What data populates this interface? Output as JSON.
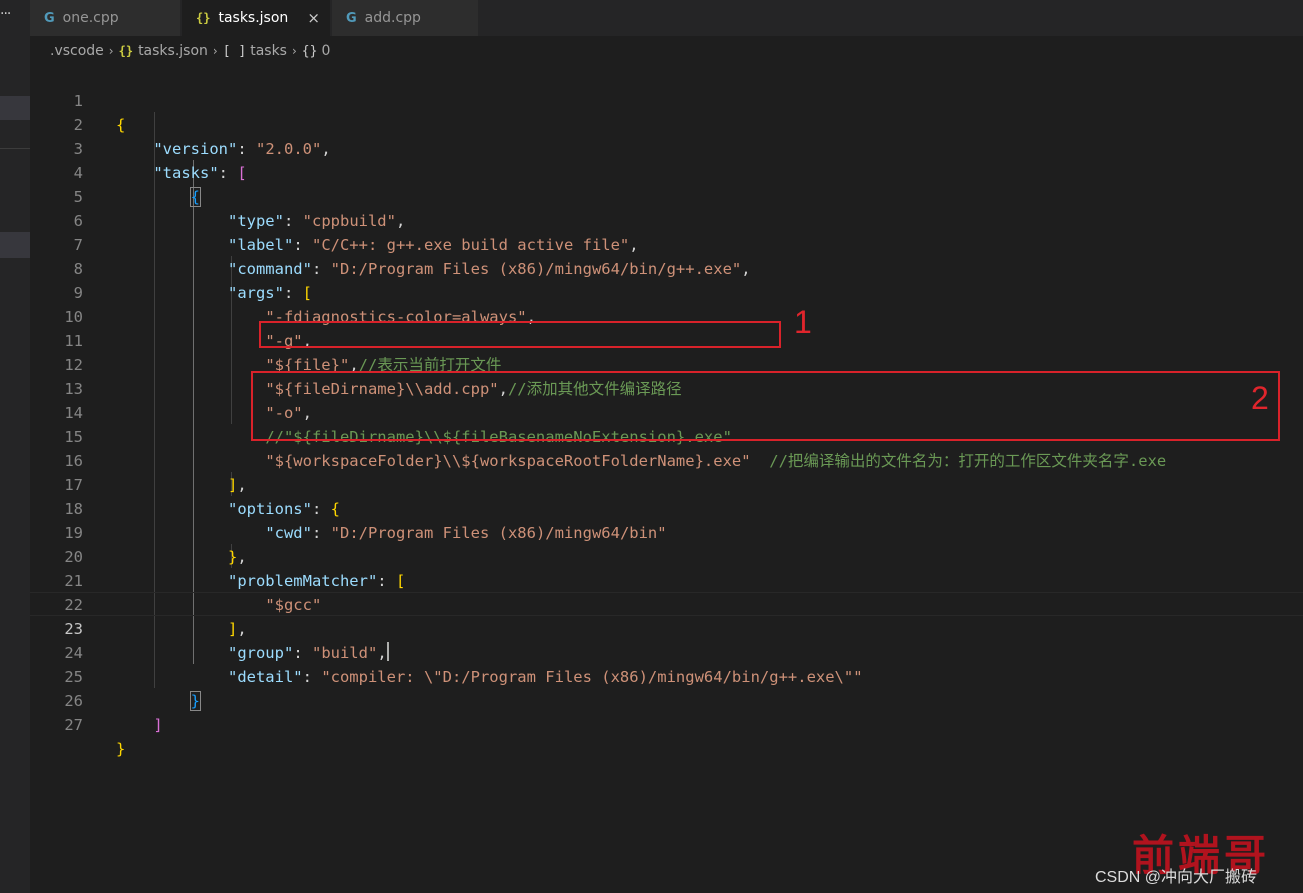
{
  "activitybar": {
    "more": "..."
  },
  "tabs": [
    {
      "label": "one.cpp",
      "icon": "cpp-file-icon",
      "icon_glyph": "G",
      "active": false
    },
    {
      "label": "tasks.json",
      "icon": "json-file-icon",
      "icon_glyph": "{}",
      "active": true,
      "close": "×"
    },
    {
      "label": "add.cpp",
      "icon": "cpp-file-icon",
      "icon_glyph": "G",
      "active": false
    }
  ],
  "breadcrumb": {
    "folder": ".vscode",
    "file_icon": "{}",
    "file": "tasks.json",
    "array_icon": "[ ]",
    "array": "tasks",
    "object_icon": "{}",
    "object": "0",
    "separator": "›"
  },
  "editor": {
    "current_line": 23,
    "line_numbers": [
      "1",
      "2",
      "3",
      "4",
      "5",
      "6",
      "7",
      "8",
      "9",
      "10",
      "11",
      "12",
      "13",
      "14",
      "15",
      "16",
      "17",
      "18",
      "19",
      "20",
      "21",
      "22",
      "23",
      "24",
      "25",
      "26",
      "27"
    ],
    "lines": {
      "l1": {
        "open": "{"
      },
      "l2": {
        "key": "\"version\"",
        "colon": ": ",
        "value": "\"2.0.0\"",
        "comma": ","
      },
      "l3": {
        "key": "\"tasks\"",
        "colon": ": ",
        "open": "["
      },
      "l4": {
        "open": "{"
      },
      "l5": {
        "key": "\"type\"",
        "colon": ": ",
        "value": "\"cppbuild\"",
        "comma": ","
      },
      "l6": {
        "key": "\"label\"",
        "colon": ": ",
        "value": "\"C/C++: g++.exe build active file\"",
        "comma": ","
      },
      "l7": {
        "key": "\"command\"",
        "colon": ": ",
        "value": "\"D:/Program Files (x86)/mingw64/bin/g++.exe\"",
        "comma": ","
      },
      "l8": {
        "key": "\"args\"",
        "colon": ": ",
        "open": "["
      },
      "l9": {
        "value": "\"-fdiagnostics-color=always\"",
        "comma": ","
      },
      "l10": {
        "value": "\"-g\"",
        "comma": ","
      },
      "l11": {
        "value": "\"${file}\"",
        "comma": ",",
        "comment": "//表示当前打开文件"
      },
      "l12": {
        "value": "\"${fileDirname}\\\\add.cpp\"",
        "comma": ",",
        "comment": "//添加其他文件编译路径"
      },
      "l13": {
        "value": "\"-o\"",
        "comma": ","
      },
      "l14": {
        "comment": "//\"${fileDirname}\\\\${fileBasenameNoExtension}.exe\""
      },
      "l15": {
        "value": "\"${workspaceFolder}\\\\${workspaceRootFolderName}.exe\"",
        "comment": "  //把编译输出的文件名为：打开的工作区文件夹名字.exe"
      },
      "l16": {
        "close": "]",
        "comma": ","
      },
      "l17": {
        "key": "\"options\"",
        "colon": ": ",
        "open": "{"
      },
      "l18": {
        "key": "\"cwd\"",
        "colon": ": ",
        "value": "\"D:/Program Files (x86)/mingw64/bin\""
      },
      "l19": {
        "close": "}",
        "comma": ","
      },
      "l20": {
        "key": "\"problemMatcher\"",
        "colon": ": ",
        "open": "["
      },
      "l21": {
        "value": "\"$gcc\""
      },
      "l22": {
        "close": "]",
        "comma": ","
      },
      "l23": {
        "key": "\"group\"",
        "colon": ": ",
        "value": "\"build\"",
        "comma": ","
      },
      "l24": {
        "key": "\"detail\"",
        "colon": ": ",
        "value": "\"compiler: \\\"D:/Program Files (x86)/mingw64/bin/g++.exe\\\"\""
      },
      "l25": {
        "close": "}"
      },
      "l26": {
        "close": "]"
      },
      "l27": {
        "close": "}"
      }
    }
  },
  "annotations": {
    "marker1": "1",
    "marker2": "2",
    "box_color": "#d9222a"
  },
  "watermark": {
    "csdn": "CSDN @冲向大厂搬砖",
    "logo": "前端哥"
  }
}
